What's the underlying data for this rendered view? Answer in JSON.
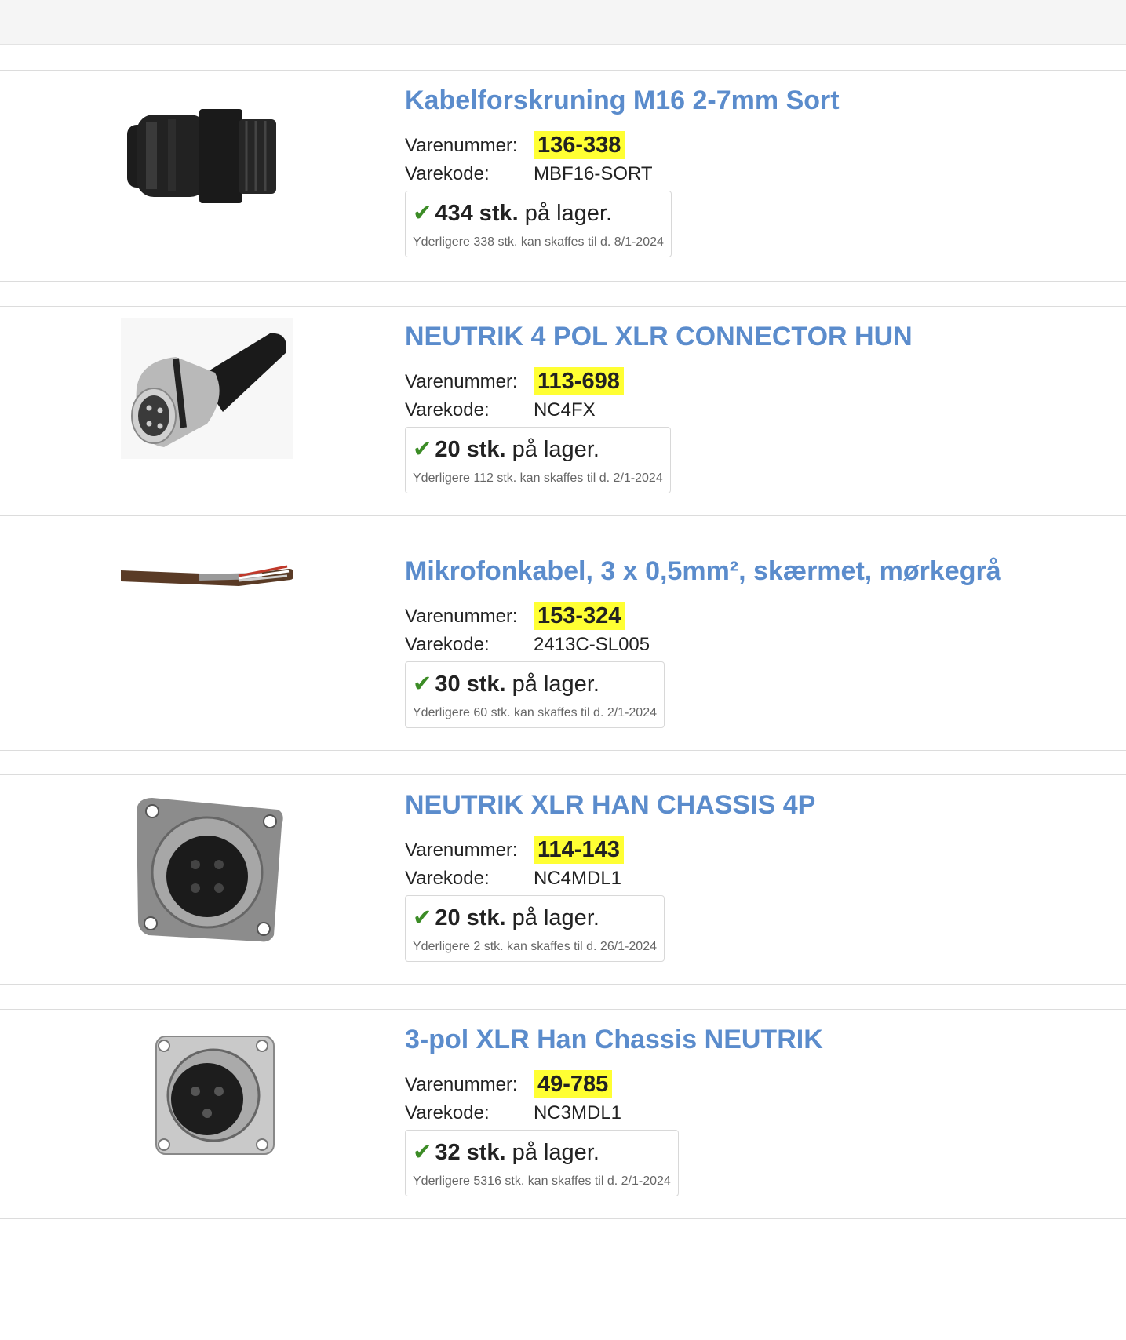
{
  "products": [
    {
      "title": "Kabelforskruning M16 2-7mm Sort",
      "varenummer_label": "Varenummer:",
      "varenummer": "136-338",
      "varekode_label": "Varekode:",
      "varekode": "MBF16-SORT",
      "stock_qty": "434 stk.",
      "stock_text": "på lager.",
      "extra": "Yderligere 338 stk. kan skaffes til d. 8/1-2024"
    },
    {
      "title": "NEUTRIK 4 POL XLR CONNECTOR HUN",
      "varenummer_label": "Varenummer:",
      "varenummer": "113-698",
      "varekode_label": "Varekode:",
      "varekode": "NC4FX",
      "stock_qty": "20 stk.",
      "stock_text": "på lager.",
      "extra": "Yderligere 112 stk. kan skaffes til d. 2/1-2024"
    },
    {
      "title": "Mikrofonkabel, 3 x 0,5mm², skærmet, mørkegrå",
      "varenummer_label": "Varenummer:",
      "varenummer": "153-324",
      "varekode_label": "Varekode:",
      "varekode": "2413C-SL005",
      "stock_qty": "30 stk.",
      "stock_text": "på lager.",
      "extra": "Yderligere 60 stk. kan skaffes til d. 2/1-2024"
    },
    {
      "title": "NEUTRIK XLR HAN CHASSIS 4P",
      "varenummer_label": "Varenummer:",
      "varenummer": "114-143",
      "varekode_label": "Varekode:",
      "varekode": "NC4MDL1",
      "stock_qty": "20 stk.",
      "stock_text": "på lager.",
      "extra": "Yderligere 2 stk. kan skaffes til d. 26/1-2024"
    },
    {
      "title": "3-pol XLR Han Chassis NEUTRIK",
      "varenummer_label": "Varenummer:",
      "varenummer": "49-785",
      "varekode_label": "Varekode:",
      "varekode": "NC3MDL1",
      "stock_qty": "32 stk.",
      "stock_text": "på lager.",
      "extra": "Yderligere 5316 stk. kan skaffes til d. 2/1-2024"
    }
  ],
  "icons": {
    "check": "✔",
    "check_color": "#3c8c26",
    "title_color": "#5b8ccc",
    "highlight_color": "#ffff33"
  }
}
